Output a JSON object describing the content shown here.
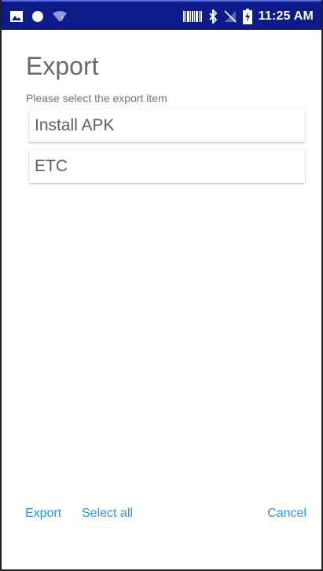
{
  "status_bar": {
    "time": "11:25 AM",
    "icons_left": [
      "image-icon",
      "circle-icon",
      "wifi-question-icon"
    ],
    "icons_right": [
      "barcode-icon",
      "bluetooth-icon",
      "no-signal-icon",
      "battery-charging-icon"
    ],
    "background": "#0d1b8a"
  },
  "dialog": {
    "title": "Export",
    "subtitle": "Please select the export item",
    "items": [
      {
        "label": "Install APK"
      },
      {
        "label": "ETC"
      }
    ],
    "actions": {
      "export_label": "Export",
      "select_all_label": "Select all",
      "cancel_label": "Cancel"
    },
    "accent_color": "#2196f3"
  }
}
